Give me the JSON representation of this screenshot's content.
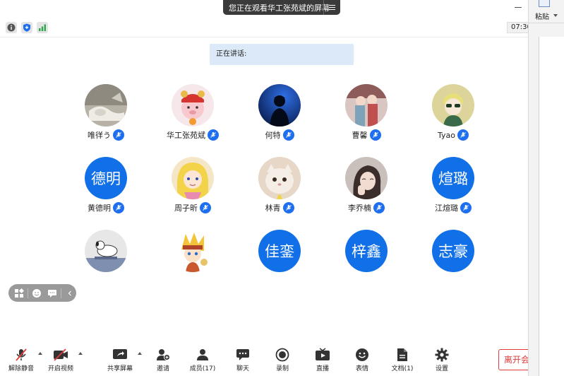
{
  "banner": {
    "text": "您正在观看华工张苑斌的屏幕"
  },
  "clock": {
    "time": "07:30"
  },
  "speaking": {
    "label": "正在讲话:"
  },
  "participants": [
    {
      "name": "唯徉う",
      "type": "photo"
    },
    {
      "name": "华工张苑斌",
      "type": "photo"
    },
    {
      "name": "何特",
      "type": "photo"
    },
    {
      "name": "曹馨",
      "type": "photo"
    },
    {
      "name": "Tyao",
      "type": "photo"
    },
    {
      "name": "黄德明",
      "initials": "德明",
      "type": "text"
    },
    {
      "name": "周子昕",
      "type": "photo"
    },
    {
      "name": "林青",
      "type": "photo"
    },
    {
      "name": "李乔楠",
      "type": "photo"
    },
    {
      "name": "江煊璐",
      "initials": "煊璐",
      "type": "text"
    },
    {
      "name": "",
      "type": "photo"
    },
    {
      "name": "",
      "type": "photo"
    },
    {
      "name": "",
      "initials": "佳銮",
      "type": "text"
    },
    {
      "name": "",
      "initials": "梓鑫",
      "type": "text"
    },
    {
      "name": "",
      "initials": "志豪",
      "type": "text"
    }
  ],
  "toolbar": {
    "unmute": "解除静音",
    "start_video": "开启视频",
    "share_screen": "共享屏幕",
    "invite": "邀请",
    "members": "成员(17)",
    "chat": "聊天",
    "record": "录制",
    "live": "直播",
    "reactions": "表情",
    "docs": "文档(1)",
    "settings": "设置",
    "leave": "离开会议"
  },
  "side_panel": {
    "paste_label": "粘贴"
  },
  "colors": {
    "accent": "#1170e8",
    "leave": "#e03b3b",
    "speaking_bg": "#dce9f8"
  }
}
